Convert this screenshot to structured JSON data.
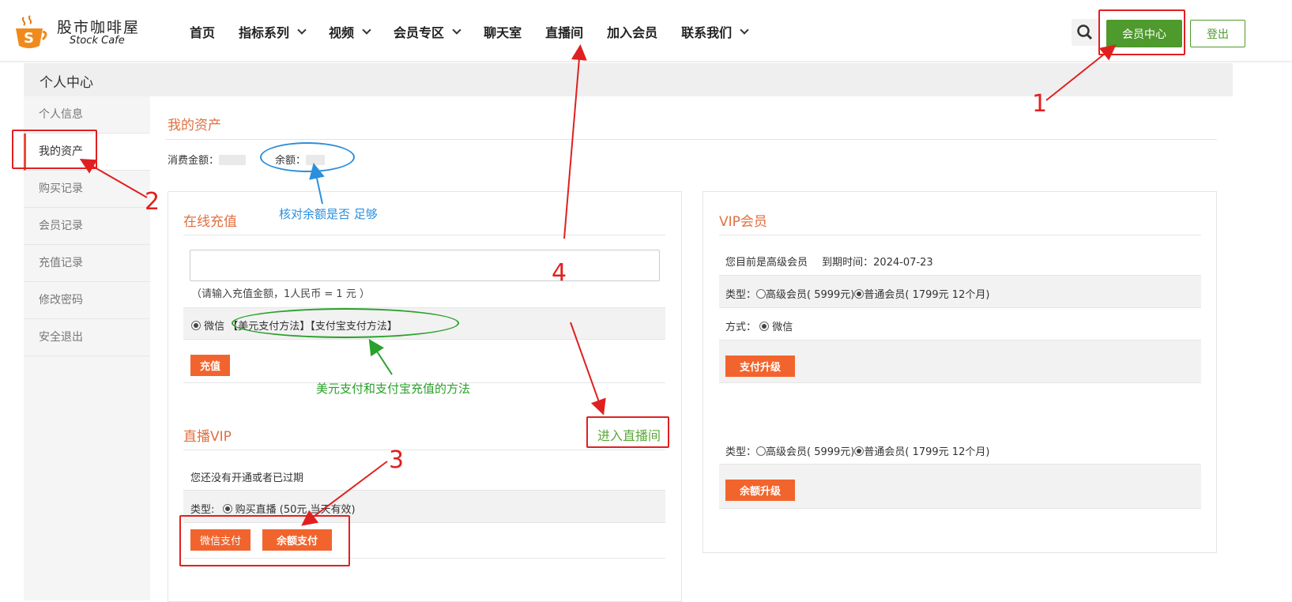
{
  "header": {
    "logo_cn": "股市咖啡屋",
    "logo_en": "Stock Cafe",
    "nav": [
      {
        "label": "首页",
        "dropdown": false
      },
      {
        "label": "指标系列",
        "dropdown": true
      },
      {
        "label": "视频",
        "dropdown": true
      },
      {
        "label": "会员专区",
        "dropdown": true
      },
      {
        "label": "聊天室",
        "dropdown": false
      },
      {
        "label": "直播间",
        "dropdown": false
      },
      {
        "label": "加入会员",
        "dropdown": false
      },
      {
        "label": "联系我们",
        "dropdown": true
      }
    ],
    "search_icon": "search-icon",
    "member_center": "会员中心",
    "logout": "登出"
  },
  "breadcrumb": "个人中心",
  "sidebar": {
    "items": [
      "个人信息",
      "我的资产",
      "购买记录",
      "会员记录",
      "充值记录",
      "修改密码",
      "安全退出"
    ],
    "active": 1
  },
  "assets": {
    "title": "我的资产",
    "spent_label": "消费金额：",
    "balance_label": "余额："
  },
  "recharge": {
    "title": "在线充值",
    "hint": "（请输入充值金额，1人民币 = 1 元 ）",
    "method_wechat": "微信",
    "usd_method": "【美元支付方法】",
    "alipay_method": "【支付宝支付方法】",
    "button": "充值"
  },
  "live": {
    "title": "直播VIP",
    "enter_link": "进入直播间",
    "status": "您还没有开通或者已过期",
    "type_label": "类型:",
    "type_option": "购买直播 (50元 当天有效)",
    "wechat_pay": "微信支付",
    "balance_pay": "余额支付"
  },
  "vip": {
    "title": "VIP会员",
    "current_status": "您目前是高级会员",
    "expire": "到期时间：2024-07-23",
    "type_label": "类型：",
    "opt_senior": "高级会员( 5999元)",
    "opt_normal": "普通会员( 1799元 12个月)",
    "method_label": "方式：",
    "method_wechat": "微信",
    "pay_upgrade": "支付升级",
    "type_label2": "类型：",
    "balance_upgrade": "余额升级"
  },
  "annotations": {
    "n1": "1",
    "n2": "2",
    "n3": "3",
    "n4": "4",
    "check_balance": "核对余额是否 足够",
    "usd_alipay_note": "美元支付和支付宝充值的方法",
    "red": "#e02020",
    "blue": "#2b8fdc",
    "green": "#2aa12a"
  }
}
